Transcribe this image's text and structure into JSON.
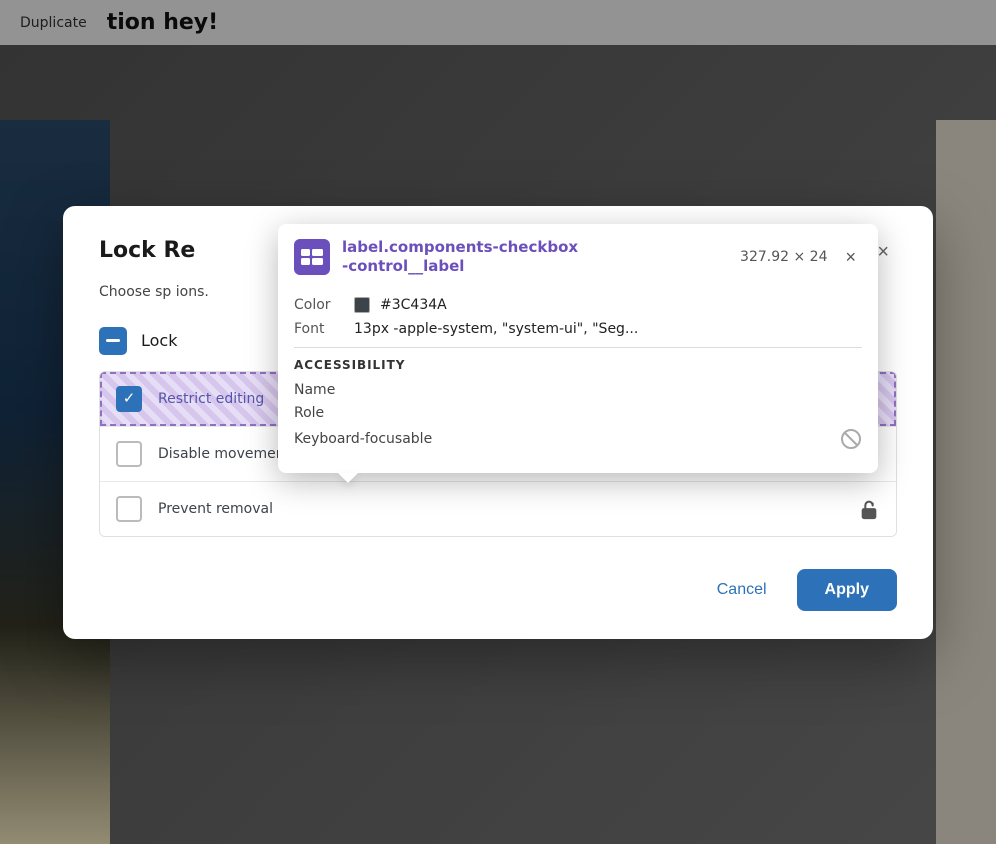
{
  "background": {
    "top_labels": [
      "Duplicate",
      "tion hey!"
    ]
  },
  "modal": {
    "title": "Lock Re",
    "description": "Choose sp                                              ions.",
    "close_label": "×",
    "lock_row": {
      "label": "Lock"
    },
    "options": [
      {
        "id": "restrict-editing",
        "label": "Restrict editing",
        "checked": true,
        "highlighted": true
      },
      {
        "id": "disable-movement",
        "label": "Disable movement",
        "checked": false,
        "highlighted": false
      },
      {
        "id": "prevent-removal",
        "label": "Prevent removal",
        "checked": false,
        "highlighted": false
      }
    ],
    "footer": {
      "cancel_label": "Cancel",
      "apply_label": "Apply"
    }
  },
  "inspector": {
    "element_name": "label.components-checkbox\n-control__label",
    "dimensions": "327.92 × 24",
    "color_label": "Color",
    "color_value": "#3C434A",
    "font_label": "Font",
    "font_value": "13px -apple-system, \"system-ui\", \"Seg...",
    "accessibility_title": "ACCESSIBILITY",
    "accessibility_rows": [
      {
        "label": "Name",
        "has_blocked": false
      },
      {
        "label": "Role",
        "has_blocked": false
      },
      {
        "label": "Keyboard-focusable",
        "has_blocked": true
      }
    ],
    "close_label": "×"
  }
}
